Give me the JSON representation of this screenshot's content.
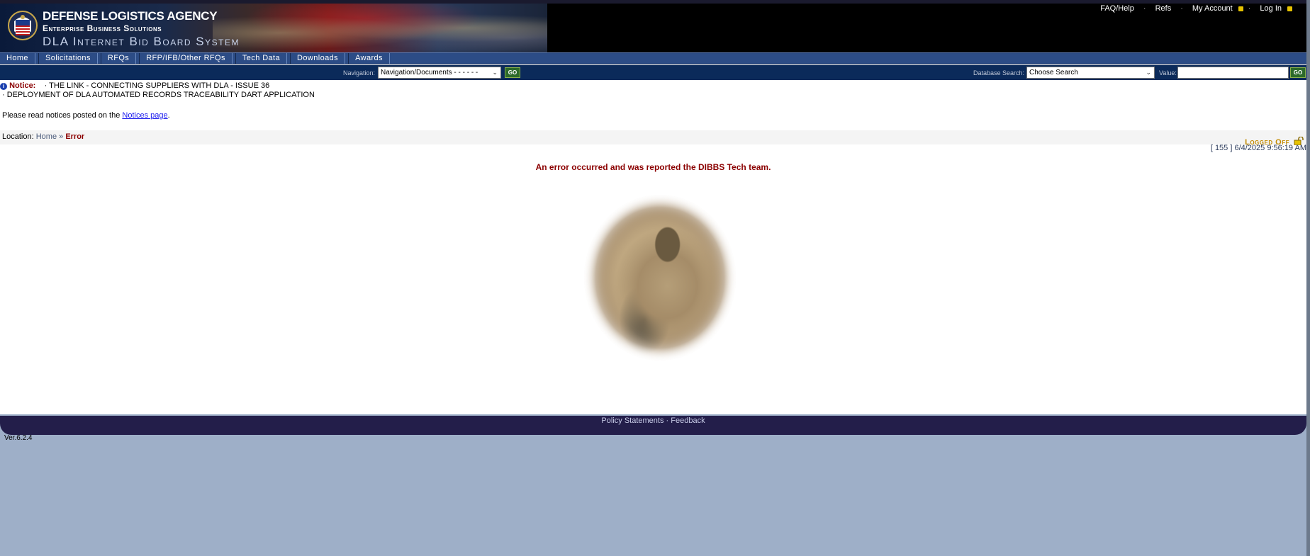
{
  "header": {
    "agency": "DEFENSE LOGISTICS AGENCY",
    "division": "Enterprise Business Solutions",
    "system": "DLA Internet Bid Board System",
    "seal_icon": "dla-seal-icon"
  },
  "toplinks": {
    "faq": "FAQ/Help",
    "refs": "Refs",
    "account": "My Account",
    "login": "Log In",
    "sep": "·"
  },
  "menu": [
    "Home",
    "Solicitations",
    "RFQs",
    "RFP/IFB/Other RFQs",
    "Tech Data",
    "Downloads",
    "Awards"
  ],
  "nav": {
    "nav_label": "Navigation:",
    "nav_value": "Navigation/Documents - - - - - -",
    "go": "GO",
    "db_label": "Database Search:",
    "db_value": "Choose Search",
    "value_label": "Value:",
    "value_text": ""
  },
  "notice": {
    "label": "Notice:",
    "item1": "· THE LINK - CONNECTING SUPPLIERS WITH DLA - ISSUE 36",
    "item2": "· DEPLOYMENT OF DLA AUTOMATED RECORDS TRACEABILITY DART APPLICATION",
    "read_prefix": "Please read notices posted on the ",
    "read_link": "Notices page",
    "read_suffix": "."
  },
  "location": {
    "label": "Location:",
    "home": "Home",
    "sep": "»",
    "current": "Error",
    "status": "Logged Off",
    "timestamp": "[ 155 ] 6/4/2025 9:56:19 AM"
  },
  "error_message": "An error occurred and was reported the DIBBS Tech team.",
  "footer": {
    "policy": "Policy Statements",
    "sep": "·",
    "feedback": "Feedback",
    "version": "Ver.6.2.4"
  },
  "colors": {
    "menu": "#2c4c86",
    "navrow": "#0b2a5a",
    "error": "#8b0000",
    "footer": "#231e4a",
    "background": "#9eafc8"
  }
}
